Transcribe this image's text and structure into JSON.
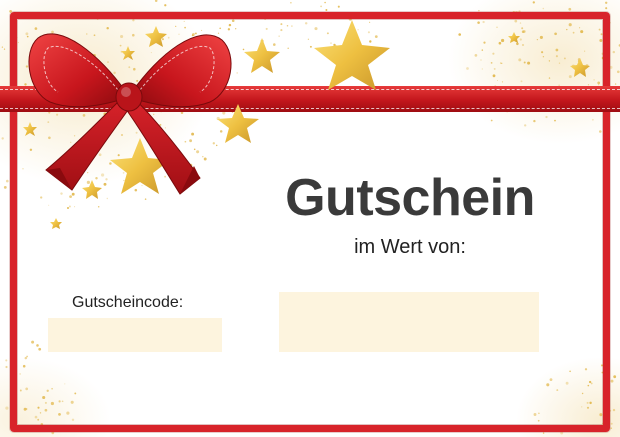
{
  "voucher": {
    "title": "Gutschein",
    "subtitle": "im Wert von:",
    "code_label": "Gutscheincode:",
    "code_value": "",
    "amount_value": ""
  },
  "colors": {
    "frame": "#d8232a",
    "ribbon": "#c3161c",
    "gold": "#e9c46a",
    "field": "#fdf4de",
    "title_text": "#3a3a3a"
  },
  "icons": [
    "red-bow-icon",
    "gold-star-icon",
    "gold-glitter"
  ]
}
